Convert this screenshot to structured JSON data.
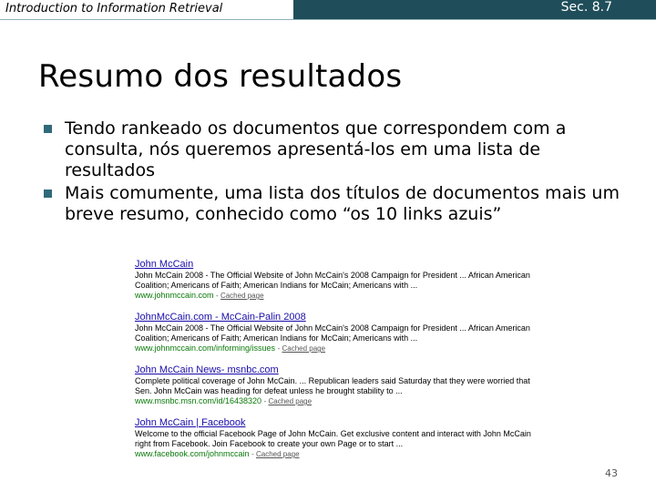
{
  "header": {
    "course_title": "Introduction to Information Retrieval",
    "section_ref": "Sec. 8.7"
  },
  "slide": {
    "title": "Resumo dos resultados",
    "bullets": [
      "Tendo rankeado os documentos que correspondem com a consulta, nós queremos apresentá-los em uma lista de resultados",
      "Mais comumente, uma lista dos títulos de documentos  mais um breve resumo, conhecido como  “os 10 links azuis”"
    ]
  },
  "results": [
    {
      "title": "John McCain",
      "snippet": "John McCain 2008 - The Official Website of John McCain's 2008 Campaign for President ... African American Coalition; Americans of Faith; American Indians for McCain; Americans with ...",
      "url": "www.johnmccain.com",
      "cached": "Cached page"
    },
    {
      "title": "JohnMcCain.com - McCain-Palin 2008",
      "snippet": "John McCain 2008 - The Official Website of John McCain's 2008 Campaign for President ... African American Coalition; Americans of Faith; American Indians for McCain; Americans with ...",
      "url": "www.johnmccain.com/informing/issues",
      "cached": "Cached page"
    },
    {
      "title": "John McCain News- msnbc.com",
      "snippet": "Complete political coverage of John McCain. ... Republican leaders said Saturday that they were worried that Sen. John McCain was heading for defeat unless he brought stability to ...",
      "url": "www.msnbc.msn.com/id/16438320",
      "cached": "Cached page"
    },
    {
      "title": "John McCain | Facebook",
      "snippet": "Welcome to the official Facebook Page of John McCain. Get exclusive content and interact with John McCain right from Facebook. Join Facebook to create your own Page or to start ...",
      "url": "www.facebook.com/johnmccain",
      "cached": "Cached page"
    }
  ],
  "page_number": "43"
}
